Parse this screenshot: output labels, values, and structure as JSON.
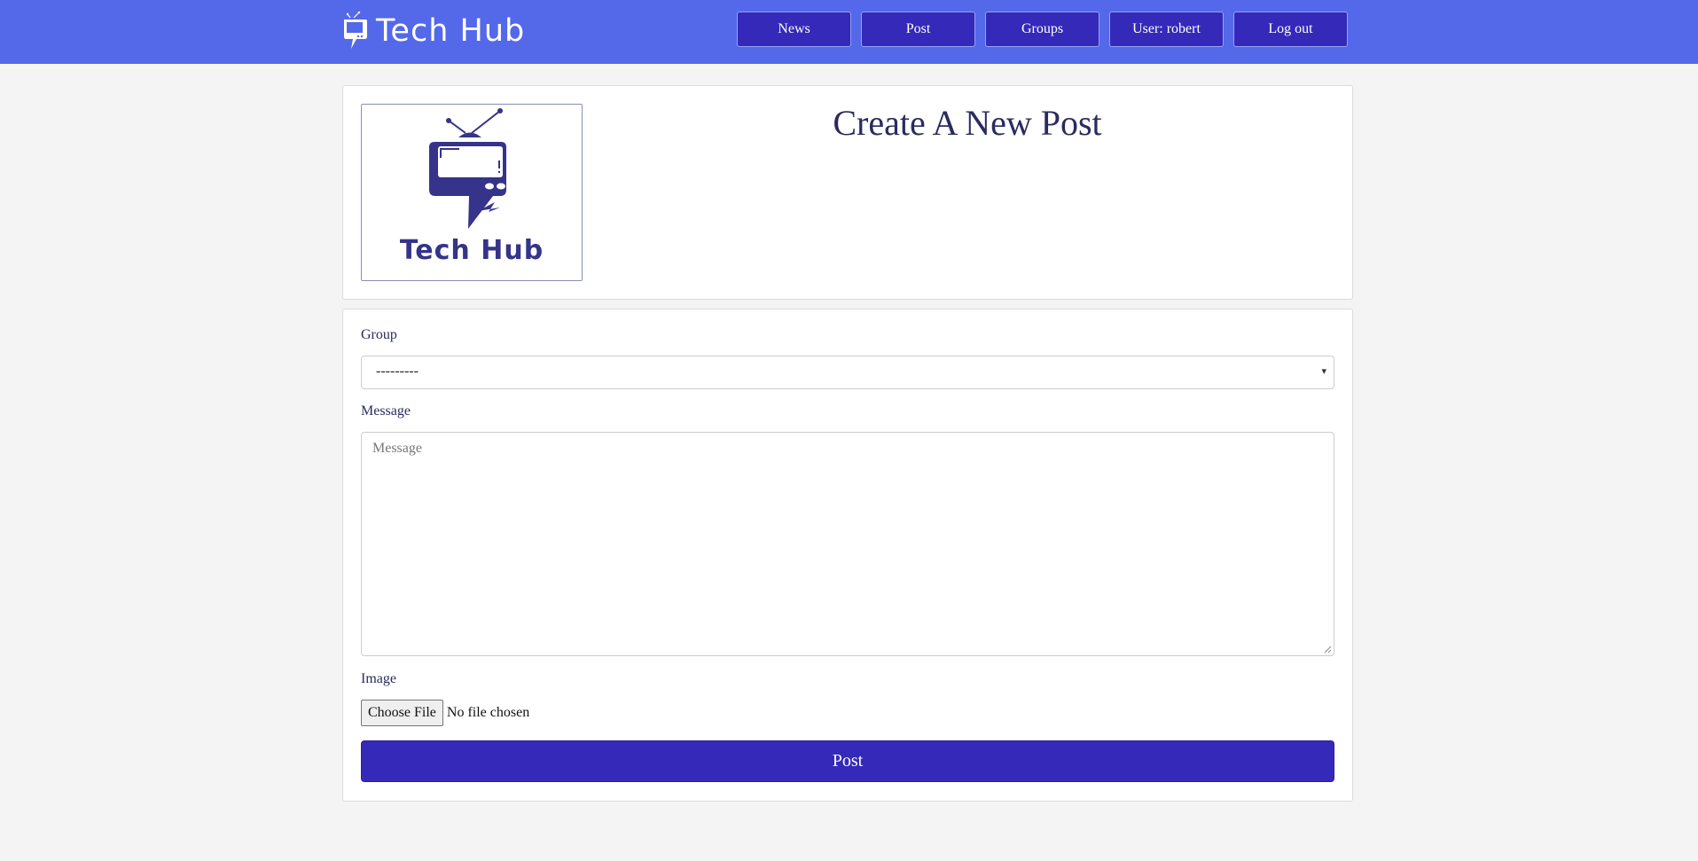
{
  "brand": {
    "name": "Tech Hub",
    "icon": "tv-chat-icon"
  },
  "nav": [
    {
      "label": "News"
    },
    {
      "label": "Post"
    },
    {
      "label": "Groups"
    },
    {
      "label": "User: robert"
    },
    {
      "label": "Log out"
    }
  ],
  "header": {
    "logo_text": "Tech Hub",
    "logo_icon": "tv-chat-icon",
    "title": "Create A New Post"
  },
  "form": {
    "group_label": "Group",
    "group_selected": "---------",
    "message_label": "Message",
    "message_placeholder": "Message",
    "message_value": "",
    "image_label": "Image",
    "file_button": "Choose File",
    "file_status": "No file chosen",
    "submit_label": "Post"
  },
  "colors": {
    "navbar": "#5468ea",
    "button": "#3429b9",
    "background": "#f4f4f4",
    "text": "#2b2b5e"
  }
}
